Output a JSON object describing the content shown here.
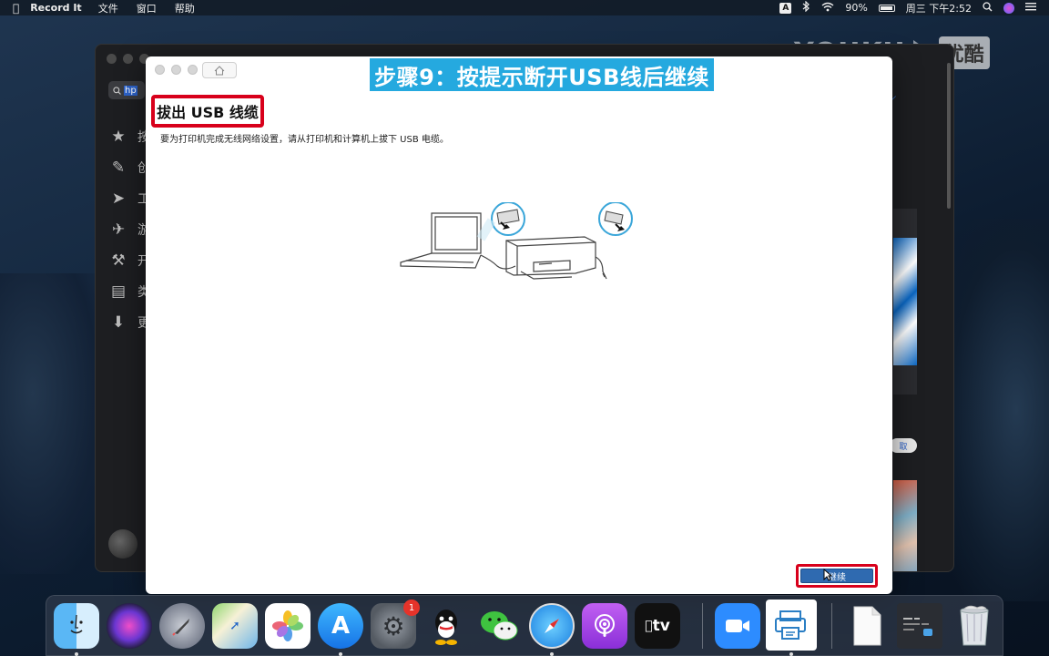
{
  "menubar": {
    "app_name": "Record It",
    "menus": [
      "文件",
      "窗口",
      "帮助"
    ],
    "input_badge": "A",
    "battery": "90%",
    "datetime": "周三 下午2:52"
  },
  "watermark": {
    "text": "YOUKU",
    "brand": "优酷"
  },
  "bg_window": {
    "search_text": "hp",
    "sidebar_chars": [
      "按",
      "创",
      "工",
      "游",
      "开",
      "类",
      "更"
    ],
    "pill_text": "取"
  },
  "hp_window": {
    "banner": "步骤9：按提示断开USB线后继续",
    "title": "拔出 USB 线缆",
    "description": "要为打印机完成无线网络设置，请从打印机和计算机上拔下 USB 电缆。",
    "continue_label": "继续"
  },
  "dock": {
    "items": [
      {
        "name": "Finder",
        "icon": "finder-icon"
      },
      {
        "name": "Siri",
        "icon": "siri-icon"
      },
      {
        "name": "Launchpad",
        "icon": "launchpad-icon"
      },
      {
        "name": "Maps",
        "icon": "maps-icon"
      },
      {
        "name": "Photos",
        "icon": "photos-icon"
      },
      {
        "name": "App Store",
        "icon": "app-store-icon"
      },
      {
        "name": "System Preferences",
        "icon": "system-preferences-icon",
        "badge": "1"
      },
      {
        "name": "QQ",
        "icon": "qq-icon"
      },
      {
        "name": "WeChat",
        "icon": "wechat-icon"
      },
      {
        "name": "Safari",
        "icon": "safari-icon"
      },
      {
        "name": "Podcasts",
        "icon": "podcasts-icon"
      },
      {
        "name": "Apple TV",
        "icon": "apple-tv-icon",
        "label": "tv"
      },
      {
        "name": "Zoom",
        "icon": "zoom-icon"
      },
      {
        "name": "HP Smart",
        "icon": "hp-smart-icon"
      },
      {
        "name": "Document",
        "icon": "document-icon"
      },
      {
        "name": "Screenshot",
        "icon": "screenshot-icon"
      },
      {
        "name": "Trash",
        "icon": "trash-icon"
      }
    ]
  },
  "colors": {
    "banner_bg": "#25a9df",
    "highlight_red": "#d8001b",
    "continue_bg": "#2f6ab0"
  }
}
